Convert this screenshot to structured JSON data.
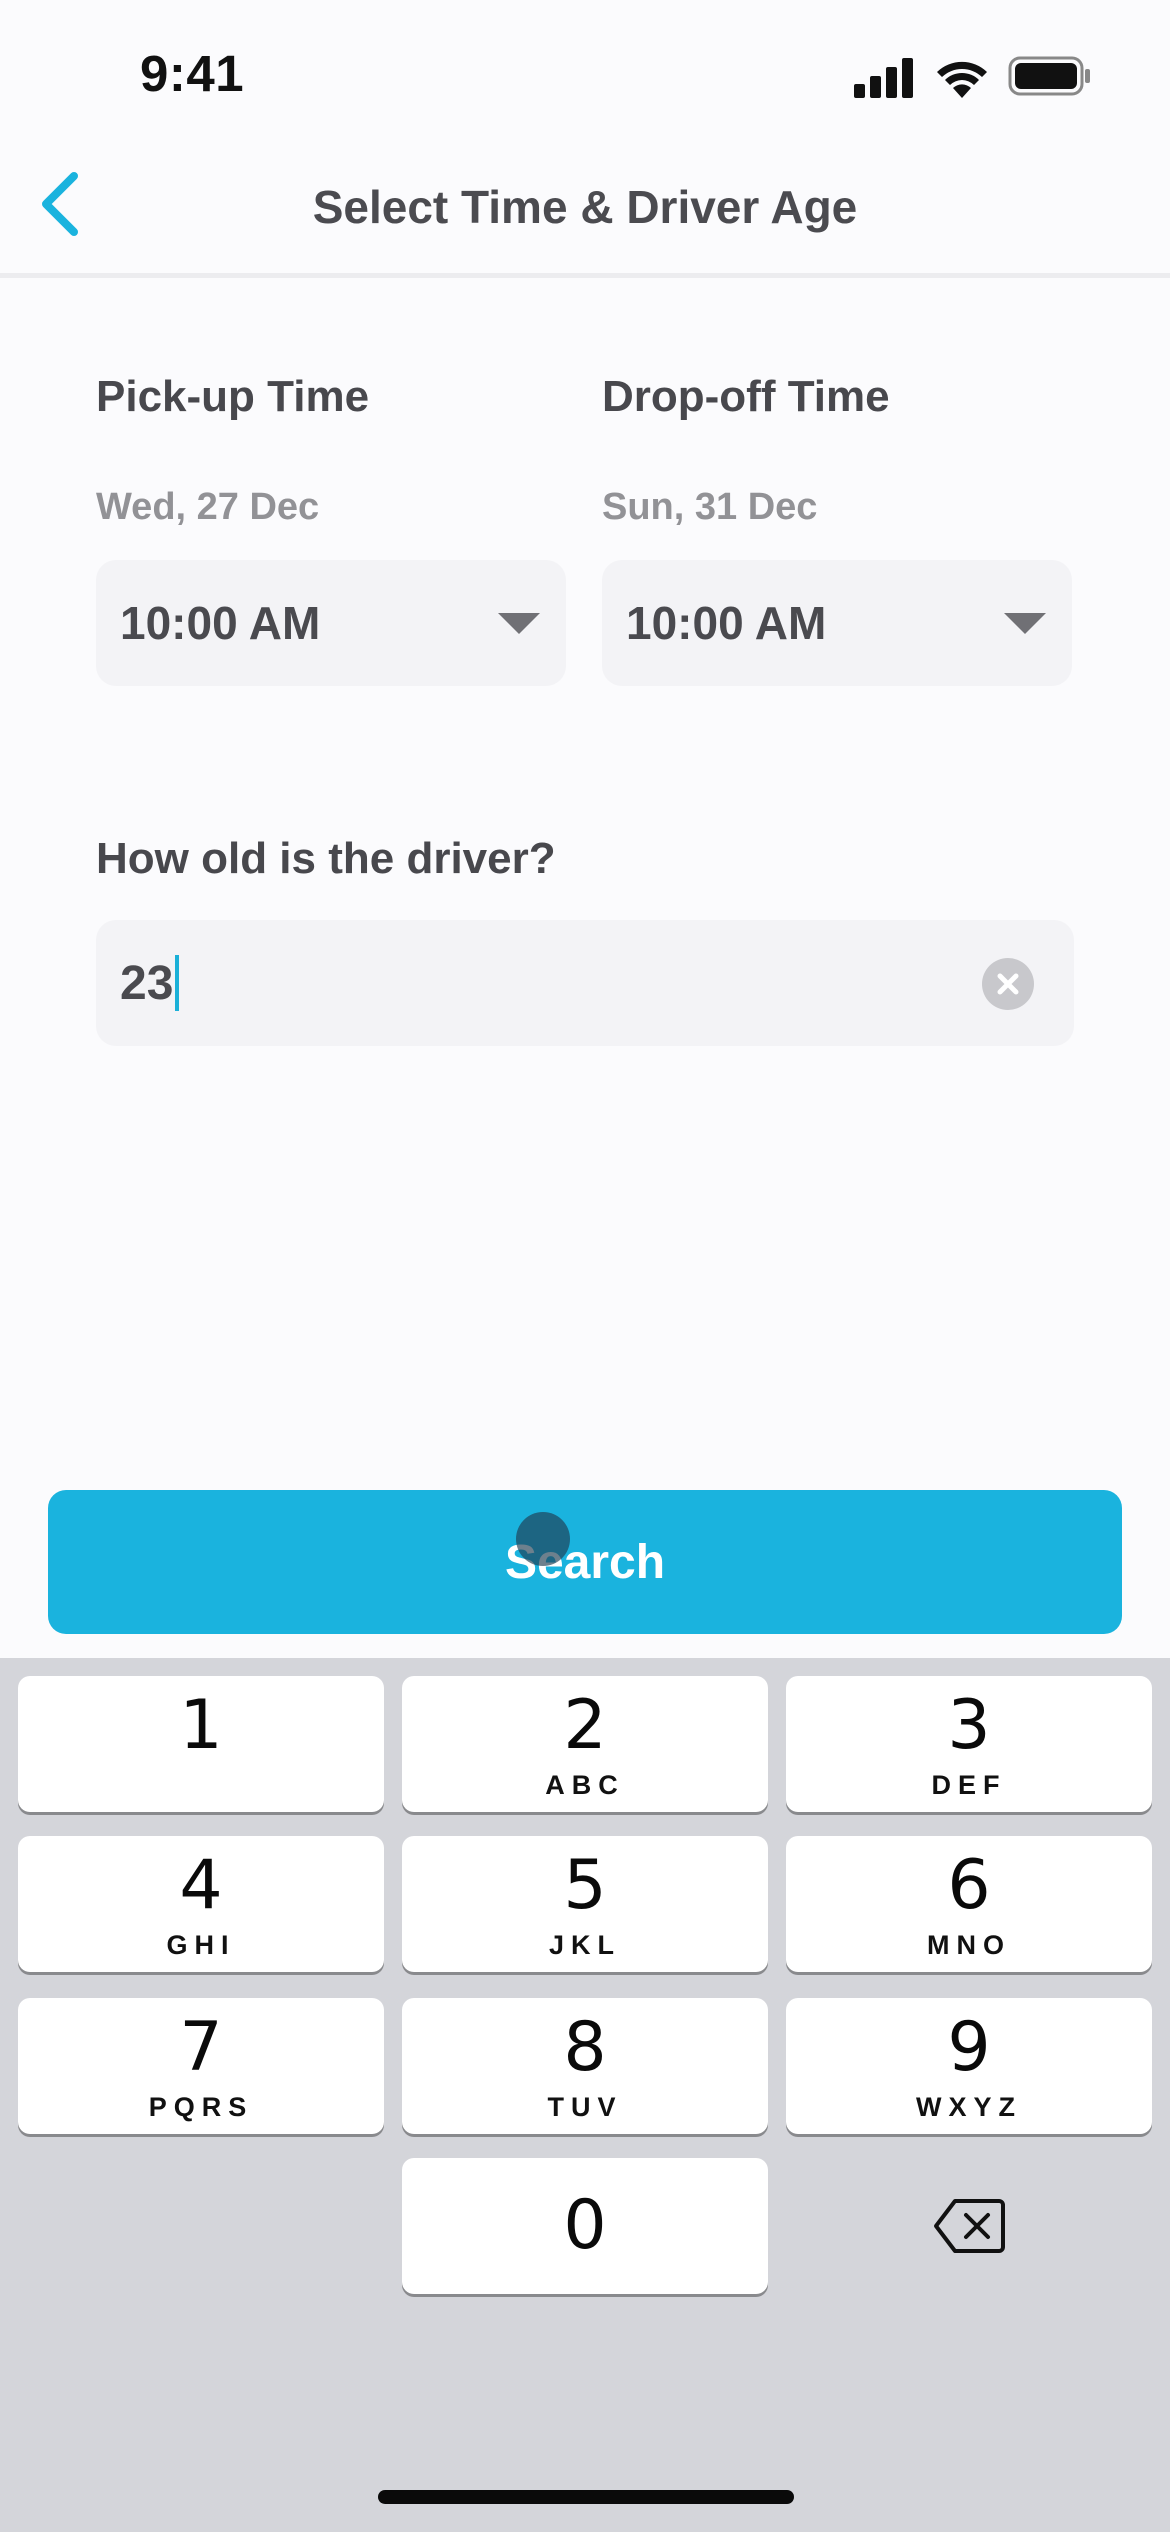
{
  "status_bar": {
    "time": "9:41"
  },
  "header": {
    "title": "Select Time & Driver Age"
  },
  "pickup": {
    "label": "Pick-up Time",
    "date": "Wed, 27 Dec",
    "time": "10:00 AM"
  },
  "dropoff": {
    "label": "Drop-off Time",
    "date": "Sun, 31 Dec",
    "time": "10:00 AM"
  },
  "driver_age": {
    "label": "How old is the driver?",
    "value": "23"
  },
  "search_button": {
    "label": "Search"
  },
  "keyboard": {
    "keys": [
      {
        "digit": "1",
        "letters": ""
      },
      {
        "digit": "2",
        "letters": "ABC"
      },
      {
        "digit": "3",
        "letters": "DEF"
      },
      {
        "digit": "4",
        "letters": "GHI"
      },
      {
        "digit": "5",
        "letters": "JKL"
      },
      {
        "digit": "6",
        "letters": "MNO"
      },
      {
        "digit": "7",
        "letters": "PQRS"
      },
      {
        "digit": "8",
        "letters": "TUV"
      },
      {
        "digit": "9",
        "letters": "WXYZ"
      },
      {
        "digit": "0",
        "letters": ""
      }
    ]
  },
  "colors": {
    "accent": "#1ab3de",
    "text": "#4a4a4f",
    "field_bg": "#f3f3f6",
    "keyboard_bg": "#d4d5da"
  }
}
